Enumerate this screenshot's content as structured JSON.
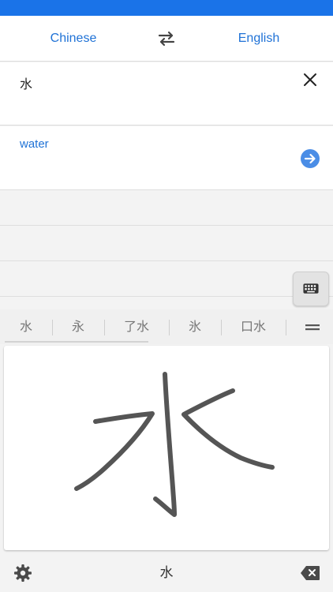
{
  "header": {
    "source_language": "Chinese",
    "target_language": "English",
    "swap_icon": "swap-arrows-icon"
  },
  "input": {
    "text": "水",
    "clear_icon": "close-icon"
  },
  "result": {
    "text": "water",
    "go_icon": "arrow-right-circle-icon"
  },
  "handwriting": {
    "candidates": [
      "水",
      "永",
      "了水",
      "氷",
      "口水"
    ],
    "menu_icon": "double-line-icon",
    "keyboard_icon": "keyboard-icon"
  },
  "bottom_bar": {
    "settings_icon": "gear-icon",
    "committed_char": "水",
    "backspace_icon": "backspace-icon"
  },
  "colors": {
    "accent": "#1a73e8",
    "language_text": "#1f72d6",
    "go_button": "#4a8de6",
    "stroke": "#555555"
  }
}
